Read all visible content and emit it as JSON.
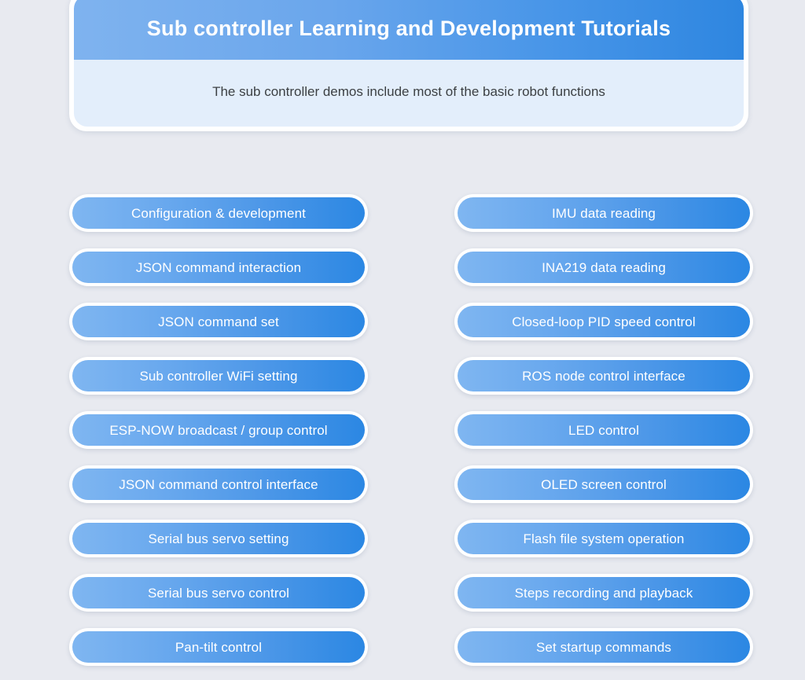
{
  "background_color": "#e8eaf0",
  "hero": {
    "title": "Sub controller Learning and Development Tutorials",
    "subtitle": "The sub controller demos include most of the basic robot functions",
    "title_gradient_from": "#7fb3ef",
    "title_gradient_to": "#2e86e0",
    "title_text_color": "#ffffff",
    "body_background": "#e3eefb",
    "body_text_color": "#3c4043",
    "card_background": "#ffffff"
  },
  "pill_style": {
    "gradient_from": "#7fb6f1",
    "gradient_to": "#2b87e3",
    "text_color": "#ffffff",
    "border_color": "#ffffff"
  },
  "columns": {
    "left": [
      {
        "label": "Configuration & development"
      },
      {
        "label": "JSON command interaction"
      },
      {
        "label": "JSON command set"
      },
      {
        "label": "Sub controller WiFi setting"
      },
      {
        "label": "ESP-NOW broadcast / group control"
      },
      {
        "label": "JSON command control interface"
      },
      {
        "label": "Serial bus servo setting"
      },
      {
        "label": "Serial bus servo control"
      },
      {
        "label": "Pan-tilt control"
      }
    ],
    "right": [
      {
        "label": "IMU data reading"
      },
      {
        "label": "INA219 data reading"
      },
      {
        "label": "Closed-loop PID speed control"
      },
      {
        "label": "ROS node control interface"
      },
      {
        "label": "LED control"
      },
      {
        "label": "OLED screen control"
      },
      {
        "label": "Flash file system operation"
      },
      {
        "label": "Steps recording and playback"
      },
      {
        "label": "Set startup commands"
      }
    ]
  }
}
